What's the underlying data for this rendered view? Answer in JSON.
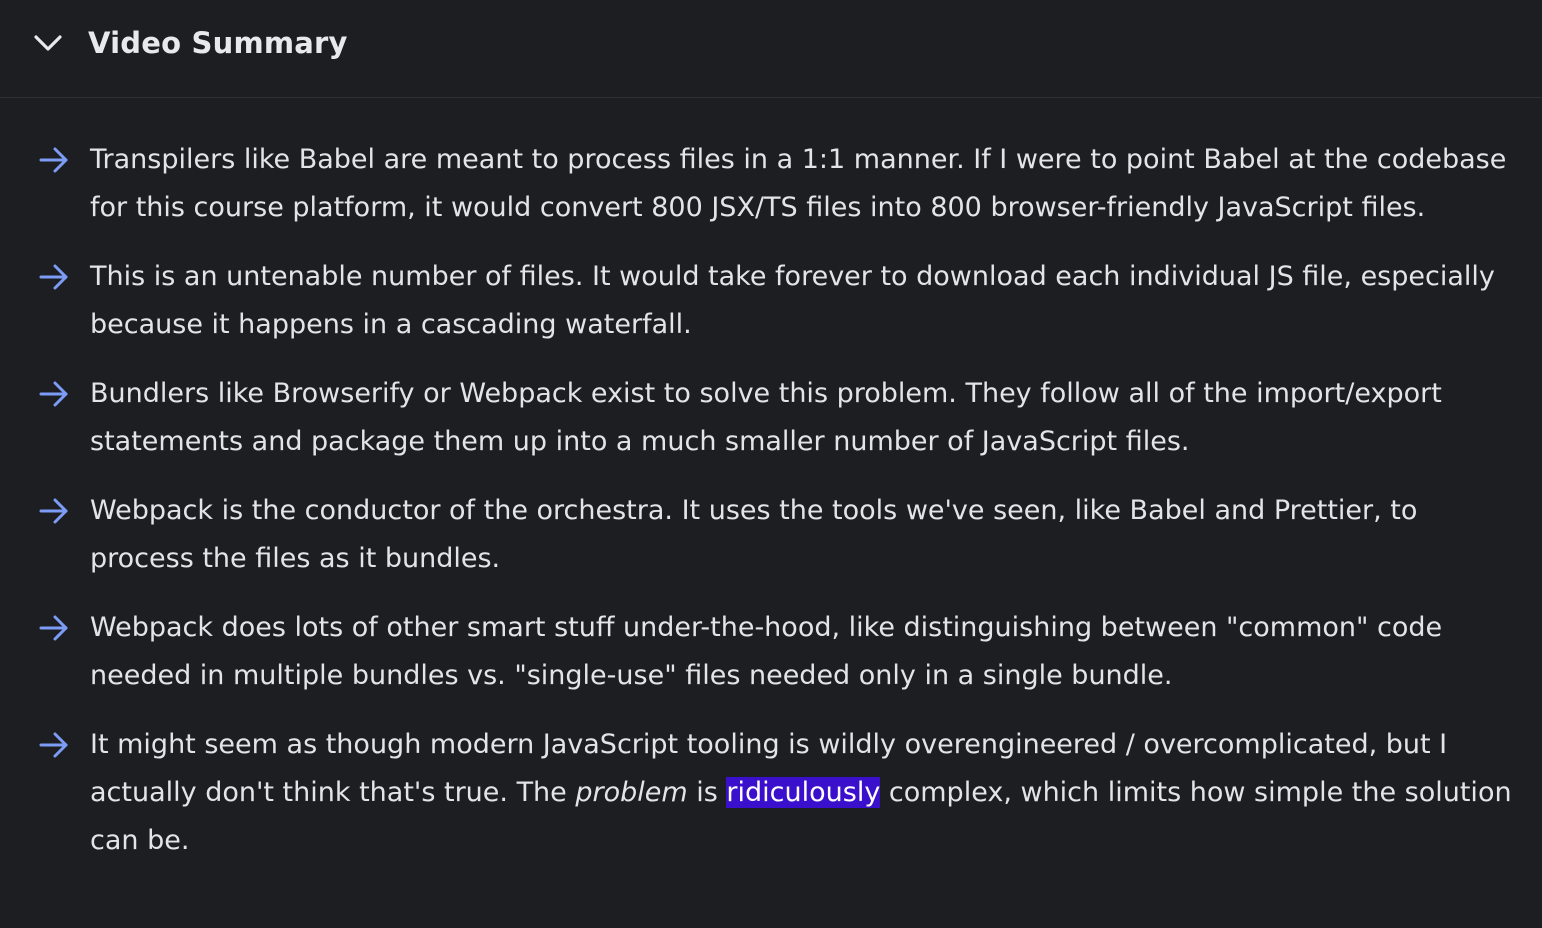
{
  "header": {
    "title": "Video Summary",
    "toggle_icon": "chevron-down-icon"
  },
  "colors": {
    "background": "#1c1e22",
    "text": "#e3e4e8",
    "arrow": "#7d9cf5",
    "highlight": "#3b10cc"
  },
  "summary": {
    "bullet_icon": "arrow-right-icon",
    "items": [
      {
        "text": "Transpilers like Babel are meant to process files in a 1:1 manner. If I were to point Babel at the codebase for this course platform, it would convert 800 JSX/TS files into 800 browser-friendly JavaScript files."
      },
      {
        "text": "This is an untenable number of files. It would take forever to download each individual JS file, especially because it happens in a cascading waterfall."
      },
      {
        "text": "Bundlers like Browserify or Webpack exist to solve this problem. They follow all of the import/export statements and package them up into a much smaller number of JavaScript files."
      },
      {
        "text": "Webpack is the conductor of the orchestra. It uses the tools we've seen, like Babel and Prettier, to process the files as it bundles."
      },
      {
        "text": "Webpack does lots of other smart stuff under-the-hood, like distinguishing between \"common\" code needed in multiple bundles vs. \"single-use\" files needed only in a single bundle."
      },
      {
        "part1": "It might seem as though modern JavaScript tooling is wildly overengineered / overcomplicated, but I actually don't think that's true. The ",
        "emphasis": "problem",
        "part2": " is ",
        "highlight": "ridiculously",
        "part3": " complex, which limits how simple the solution can be."
      }
    ]
  }
}
